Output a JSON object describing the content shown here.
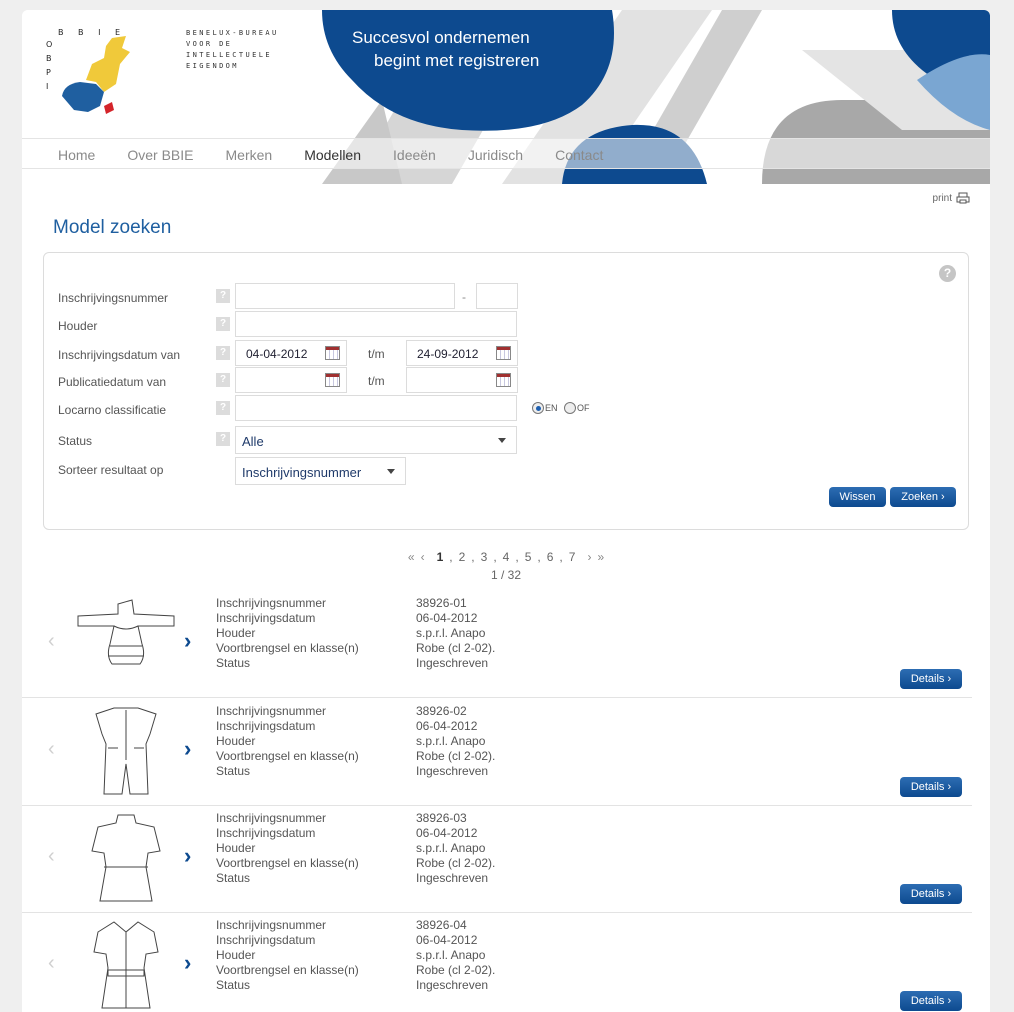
{
  "header": {
    "logo_top": "B B I E",
    "logo_side": "O B P I",
    "org_lines": [
      "BENELUX-BUREAU",
      "VOOR DE",
      "INTELLECTUELE",
      "EIGENDOM"
    ],
    "slogan_line1": "Succesvol ondernemen",
    "slogan_line2": "begint met registreren"
  },
  "nav": {
    "items": [
      "Home",
      "Over BBIE",
      "Merken",
      "Modellen",
      "Ideeën",
      "Juridisch",
      "Contact"
    ],
    "active": "Modellen"
  },
  "print_label": "print",
  "page_title": "Model zoeken",
  "form": {
    "help_icon": "?",
    "qmark": "?",
    "labels": {
      "reg_number": "Inschrijvingsnummer",
      "holder": "Houder",
      "reg_date_from": "Inschrijvingsdatum van",
      "pub_date_from": "Publicatiedatum van",
      "locarno": "Locarno classificatie",
      "status": "Status",
      "sort": "Sorteer resultaat op"
    },
    "dash": "-",
    "tm": "t/m",
    "reg_date_from_value": "04-04-2012",
    "reg_date_to_value": "24-09-2012",
    "radio_en": "EN",
    "radio_of": "OF",
    "status_value": "Alle",
    "sort_value": "Inschrijvingsnummer",
    "clear_button": "Wissen",
    "search_button": "Zoeken"
  },
  "pagination": {
    "first": "«",
    "prev": "‹",
    "pages": [
      "1",
      "2",
      "3",
      "4",
      "5",
      "6",
      "7"
    ],
    "next": "›",
    "last": "»",
    "count": "1 / 32"
  },
  "result_labels": [
    "Inschrijvingsnummer",
    "Inschrijvingsdatum",
    "Houder",
    "Voortbrengsel en klasse(n)",
    "Status"
  ],
  "details_label": "Details",
  "results": [
    {
      "values": [
        "38926-01",
        "06-04-2012",
        "s.p.r.l. Anapo",
        "Robe (cl 2-02).",
        "Ingeschreven"
      ]
    },
    {
      "values": [
        "38926-02",
        "06-04-2012",
        "s.p.r.l. Anapo",
        "Robe (cl 2-02).",
        "Ingeschreven"
      ]
    },
    {
      "values": [
        "38926-03",
        "06-04-2012",
        "s.p.r.l. Anapo",
        "Robe (cl 2-02).",
        "Ingeschreven"
      ]
    },
    {
      "values": [
        "38926-04",
        "06-04-2012",
        "s.p.r.l. Anapo",
        "Robe (cl 2-02).",
        "Ingeschreven"
      ]
    }
  ],
  "colors": {
    "brand_blue": "#0d4a8f",
    "title_blue": "#1f5fa0",
    "logo_yellow": "#f0c93a",
    "logo_red": "#d4242a"
  }
}
